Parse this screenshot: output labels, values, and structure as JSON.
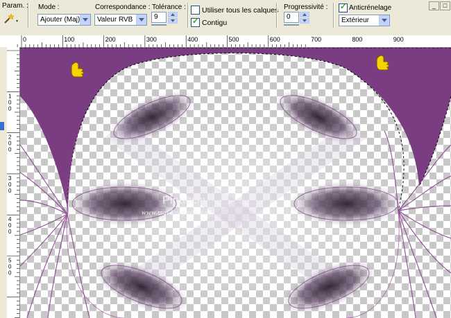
{
  "toolbar": {
    "param_label": "Param. :",
    "mode": {
      "label": "Mode :",
      "value": "Ajouter (Maj)"
    },
    "correspondance": {
      "label": "Correspondance :",
      "value": "Valeur RVB"
    },
    "tolerance": {
      "label": "Tolérance :",
      "value": "9"
    },
    "use_all_layers": {
      "label": "Utiliser tous les calques",
      "checked": false
    },
    "contigu": {
      "label": "Contigu",
      "checked": true
    },
    "progressivite": {
      "label": "Progressivité :",
      "value": "0"
    },
    "anticrenelage": {
      "label": "Anticrénelage",
      "checked": true,
      "mode": "Extérieur"
    },
    "window_buttons": [
      "_",
      "□"
    ]
  },
  "icons": {
    "tool": "magic-wand-icon",
    "hand_left": "pointing-hand-icon",
    "hand_right": "pointing-hand-icon"
  },
  "ruler_top_labels": [
    "0",
    "100",
    "200",
    "300",
    "400",
    "500",
    "600",
    "700",
    "800",
    "900"
  ],
  "ruler_left_labels": [
    "1\n0\n0",
    "2\n0\n0",
    "3\n0\n0",
    "4\n0\n0",
    "5\n0\n0"
  ],
  "canvas": {
    "watermark_title": "Pinuccia",
    "watermark_url": "www.maidiregrafica.eu",
    "colors": {
      "purple": "#7b3d82",
      "checker_dark": "#c8c8c8",
      "checker_light": "#ffffff"
    }
  }
}
